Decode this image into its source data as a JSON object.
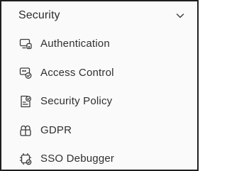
{
  "section": {
    "title": "Security",
    "toggle_icon": "chevron-down-icon",
    "expanded": true
  },
  "menu": {
    "items": [
      {
        "label": "Authentication",
        "icon": "auth-device-icon"
      },
      {
        "label": "Access Control",
        "icon": "access-control-icon"
      },
      {
        "label": "Security Policy",
        "icon": "security-policy-icon"
      },
      {
        "label": "GDPR",
        "icon": "gdpr-icon"
      },
      {
        "label": "SSO Debugger",
        "icon": "sso-debugger-icon"
      }
    ]
  },
  "colors": {
    "border": "#1f1f1f",
    "background": "#fafafa",
    "text": "#2f2f2f",
    "icon": "#3a3a3a"
  }
}
